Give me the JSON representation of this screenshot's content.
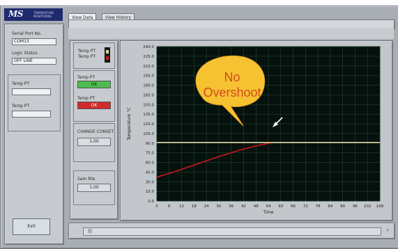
{
  "tabs": [
    "View Data",
    "View History"
  ],
  "logo": {
    "mark": "MS",
    "sub": [
      "TEMPERATURE",
      "MONITORING"
    ]
  },
  "left_panel": {
    "serial_label": "Serial Port No.",
    "serial_value": "COM13",
    "logo_status_label": "Logic Status",
    "logo_status_value": "OFF LINE",
    "temp1_label": "Temp PT",
    "temp1_value": "",
    "temp2_label": "Temp PT",
    "temp2_value": "",
    "exit_label": "Exit"
  },
  "side_panel": {
    "legend_lines": [
      "Temp PT",
      "Temp PT"
    ],
    "green_label": "Temp PT",
    "green_value": "OK",
    "red_label": "Temp PT",
    "red_value": "OK",
    "change_label": "CHANGE CONSET",
    "change_value": "1.00",
    "sample_label": "Sam Rte",
    "sample_value": "1.00"
  },
  "bubble": {
    "line1": "No",
    "line2": "Overshoot"
  },
  "footer": {
    "track_text": "|||"
  },
  "chart_data": {
    "type": "line",
    "title": "",
    "xlabel": "Time",
    "ylabel": "Temperature °C",
    "xlim": [
      0,
      108
    ],
    "ylim": [
      0,
      240
    ],
    "xticks": [
      0,
      6,
      12,
      18,
      24,
      30,
      36,
      42,
      48,
      54,
      60,
      66,
      72,
      78,
      84,
      90,
      96,
      102,
      108
    ],
    "yticks": [
      0,
      15,
      30,
      45,
      60,
      75,
      90,
      105,
      120,
      135,
      150,
      165,
      180,
      195,
      210,
      225,
      240
    ],
    "grid": true,
    "series": [
      {
        "name": "",
        "color": "#cc1a1a",
        "points": [
          [
            0,
            37
          ],
          [
            10,
            47
          ],
          [
            20,
            58
          ],
          [
            30,
            69
          ],
          [
            40,
            79
          ],
          [
            50,
            87
          ],
          [
            56,
            91
          ]
        ]
      },
      {
        "name": "",
        "color": "#d8d39a",
        "points": [
          [
            0,
            91
          ],
          [
            108,
            91
          ]
        ]
      }
    ],
    "colors": {
      "bg": "#05110c",
      "grid": "#2c503f",
      "axis": "#c9ced2"
    }
  }
}
